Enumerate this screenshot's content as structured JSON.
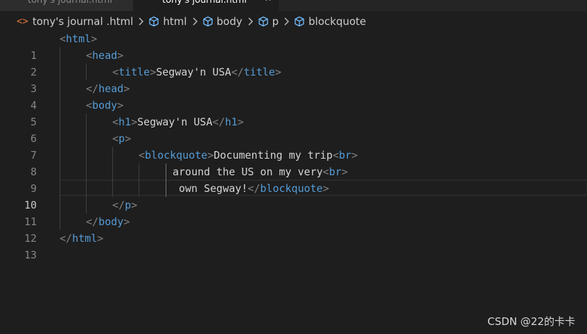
{
  "tabs": [
    {
      "label": "tony's journal.html",
      "active": false
    },
    {
      "label": "tony's journal.html",
      "active": true
    }
  ],
  "breadcrumb": {
    "file": "tony's journal .html",
    "items": [
      "html",
      "body",
      "p",
      "blockquote"
    ]
  },
  "editor": {
    "active_line": 10,
    "lines": [
      {
        "n": "1"
      },
      {
        "n": "2"
      },
      {
        "n": "3"
      },
      {
        "n": "4"
      },
      {
        "n": "5"
      },
      {
        "n": "6"
      },
      {
        "n": "7"
      },
      {
        "n": "8"
      },
      {
        "n": "9"
      },
      {
        "n": "10"
      },
      {
        "n": "11"
      },
      {
        "n": "12"
      },
      {
        "n": "13"
      }
    ],
    "code": {
      "l3_text": "Segway'n USA",
      "l6_text": "Segway'n USA",
      "l8_text": "Documenting my trip",
      "l9_text": "around the US on my very",
      "l10_text": "own Segway!"
    }
  },
  "watermark": "CSDN @22的卡卡",
  "colors": {
    "background": "#1e1e1e",
    "tag_name": "#569cd6",
    "bracket": "#808080",
    "text": "#d4d4d4",
    "line_number": "#858585",
    "html_icon": "#e37933"
  }
}
